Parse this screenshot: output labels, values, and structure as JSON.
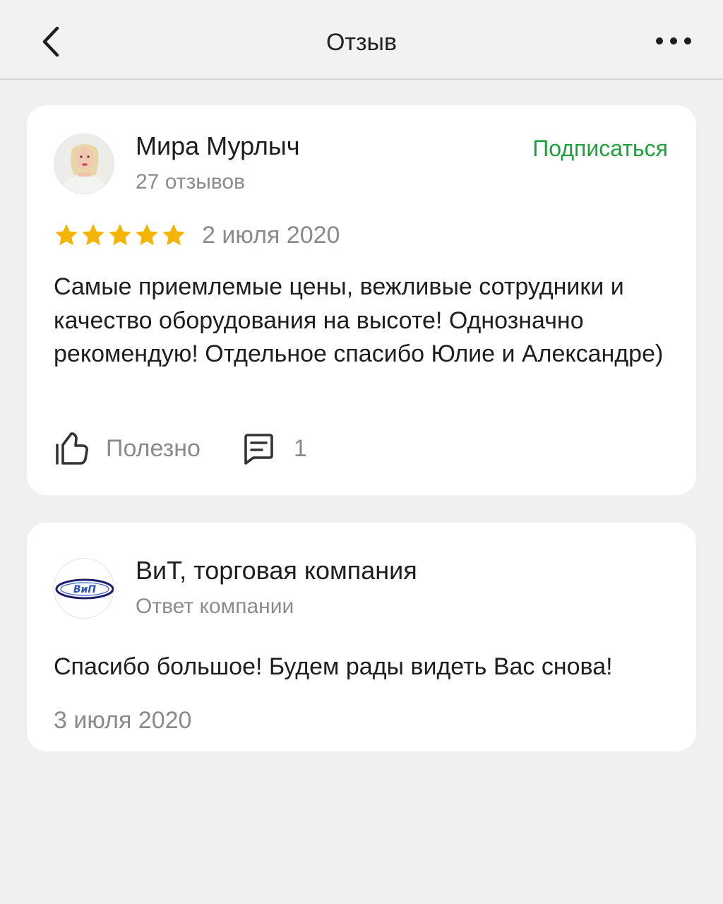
{
  "header": {
    "title": "Отзыв",
    "back_icon": "chevron-left-icon",
    "more_icon": "more-horizontal-icon"
  },
  "review": {
    "author_name": "Мира Мурлыч",
    "author_reviews_count": "27 отзывов",
    "subscribe_label": "Подписаться",
    "rating": 5,
    "rating_max": 5,
    "date": "2 июля 2020",
    "text": "Самые приемлемые цены, вежливые сотрудники и качество оборудования на высоте! Однозначно рекомендую! Отдельное спасибо Юлие и Александре)",
    "useful_label": "Полезно",
    "comments_count": "1"
  },
  "reply": {
    "company_name": "ВиТ, торговая компания",
    "subtitle": "Ответ компании",
    "logo_text": "ВиП",
    "text": "Спасибо большое! Будем рады видеть Вас снова!",
    "date": "3 июля 2020"
  },
  "colors": {
    "accent_green": "#1f9e3c",
    "star_gold": "#f4b400",
    "secondary_text": "#8a8a8a",
    "background": "#f0f0f0",
    "card": "#ffffff"
  }
}
